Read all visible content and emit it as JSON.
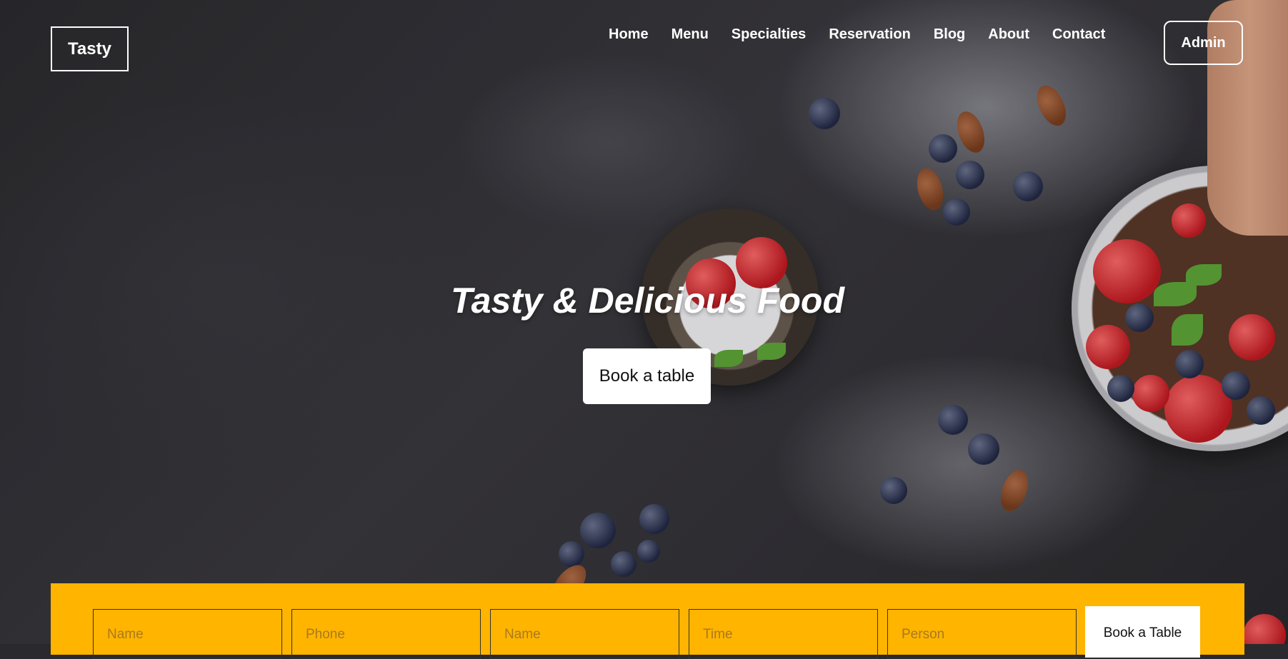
{
  "brand": {
    "logo": "Tasty"
  },
  "nav": {
    "items": [
      "Home",
      "Menu",
      "Specialties",
      "Reservation",
      "Blog",
      "About",
      "Contact"
    ],
    "admin_label": "Admin"
  },
  "hero": {
    "title": "Tasty & Delicious Food",
    "button_label": "Book a table"
  },
  "booking": {
    "fields": [
      {
        "placeholder": "Name"
      },
      {
        "placeholder": "Phone"
      },
      {
        "placeholder": "Name"
      },
      {
        "placeholder": "Time"
      },
      {
        "placeholder": "Person"
      }
    ],
    "submit_label": "Book a Table"
  },
  "colors": {
    "accent": "#ffb400",
    "text_light": "#ffffff",
    "background_dark": "#2a2a2e"
  }
}
